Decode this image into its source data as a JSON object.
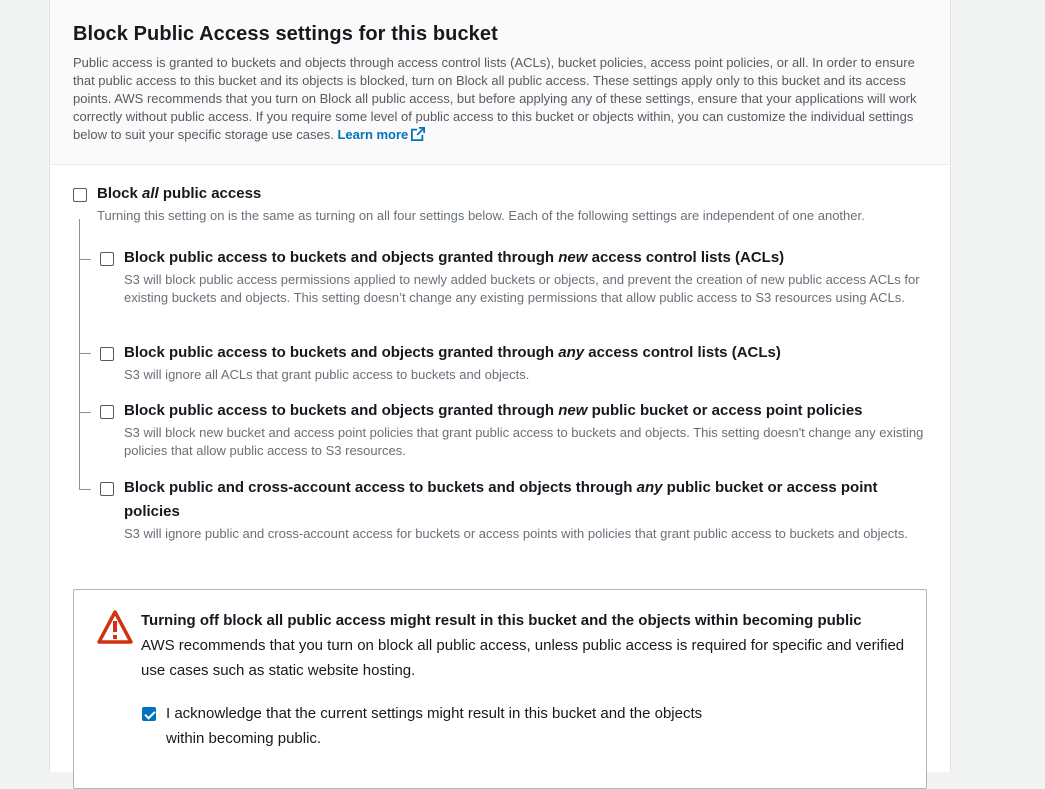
{
  "section": {
    "title": "Block Public Access settings for this bucket",
    "description": "Public access is granted to buckets and objects through access control lists (ACLs), bucket policies, access point policies, or all. In order to ensure that public access to this bucket and its objects is blocked, turn on Block all public access. These settings apply only to this bucket and its access points. AWS recommends that you turn on Block all public access, but before applying any of these settings, ensure that your applications will work correctly without public access. If you require some level of public access to this bucket or objects within, you can customize the individual settings below to suit your specific storage use cases.",
    "learn_more": "Learn more"
  },
  "block_all": {
    "title_pre": "Block ",
    "title_em": "all",
    "title_post": " public access",
    "description": "Turning this setting on is the same as turning on all four settings below. Each of the following settings are independent of one another.",
    "checked": false
  },
  "options": [
    {
      "title_pre": "Block public access to buckets and objects granted through ",
      "title_em": "new",
      "title_post": " access control lists (ACLs)",
      "description": "S3 will block public access permissions applied to newly added buckets or objects, and prevent the creation of new public access ACLs for existing buckets and objects. This setting doesn’t change any existing permissions that allow public access to S3 resources using ACLs.",
      "checked": false
    },
    {
      "title_pre": "Block public access to buckets and objects granted through ",
      "title_em": "any",
      "title_post": " access control lists (ACLs)",
      "description": "S3 will ignore all ACLs that grant public access to buckets and objects.",
      "checked": false
    },
    {
      "title_pre": "Block public access to buckets and objects granted through ",
      "title_em": "new",
      "title_post": " public bucket or access point policies",
      "description": "S3 will block new bucket and access point policies that grant public access to buckets and objects. This setting doesn't change any existing policies that allow public access to S3 resources.",
      "checked": false
    },
    {
      "title_pre": "Block public and cross-account access to buckets and objects through ",
      "title_em": "any",
      "title_post": " public bucket or access point policies",
      "description": "S3 will ignore public and cross-account access for buckets or access points with policies that grant public access to buckets and objects.",
      "checked": false
    }
  ],
  "warning": {
    "title": "Turning off block all public access might result in this bucket and the objects within becoming public",
    "text": "AWS recommends that you turn on block all public access, unless public access is required for specific and verified use cases such as static website hosting.",
    "acknowledge_label": "I acknowledge that the current settings might result in this bucket and the objects within becoming public.",
    "acknowledged": true,
    "icon": "warning-triangle-icon",
    "color": "#d13212"
  },
  "colors": {
    "link": "#0073bb",
    "checkbox_checked": "#0073bb"
  }
}
